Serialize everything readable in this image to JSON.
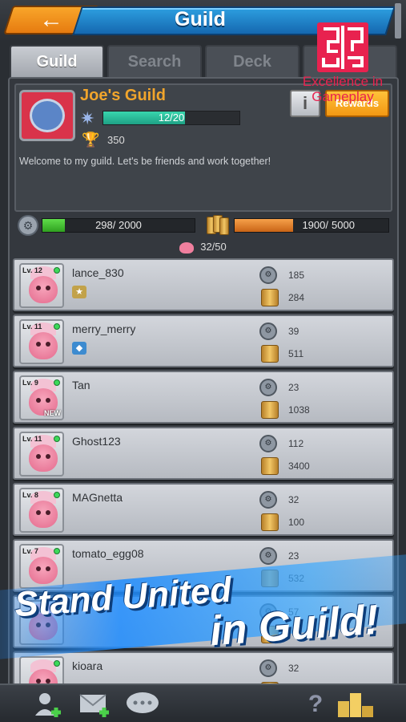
{
  "header": {
    "title": "Guild",
    "back_icon": "←"
  },
  "tabs": [
    {
      "label": "Guild",
      "active": true
    },
    {
      "label": "Search",
      "active": false
    },
    {
      "label": "Deck",
      "active": false
    },
    {
      "label": "",
      "active": false
    }
  ],
  "overlay_logo": {
    "caption": "Excellence in Gameplay"
  },
  "guild": {
    "name": "Joe's Guild",
    "level_text": "12/20",
    "level_progress": 0.6,
    "trophies": "350",
    "info_label": "i",
    "action_label": "Rewards",
    "welcome": "Welcome to my guild. Let's be friends and work together!"
  },
  "resources": {
    "left": {
      "text": "298/ 2000",
      "progress": 0.149
    },
    "right": {
      "text_a": "1900/",
      "text_b": "5000",
      "progress": 0.38
    }
  },
  "member_count": "32/50",
  "members": [
    {
      "level": "Lv. 12",
      "name": "lance_830",
      "stat1": "185",
      "stat2": "284",
      "rank": "★",
      "new": ""
    },
    {
      "level": "Lv. 11",
      "name": "merry_merry",
      "stat1": "39",
      "stat2": "511",
      "rank": "◆",
      "new": ""
    },
    {
      "level": "Lv. 9",
      "name": "Tan",
      "stat1": "23",
      "stat2": "1038",
      "rank": "",
      "new": "NEW"
    },
    {
      "level": "Lv. 11",
      "name": "Ghost123",
      "stat1": "112",
      "stat2": "3400",
      "rank": "",
      "new": ""
    },
    {
      "level": "Lv. 8",
      "name": "MAGnetta",
      "stat1": "32",
      "stat2": "100",
      "rank": "",
      "new": ""
    },
    {
      "level": "Lv. 7",
      "name": "tomato_egg08",
      "stat1": "23",
      "stat2": "532",
      "rank": "",
      "new": ""
    },
    {
      "level": "",
      "name": "",
      "stat1": "57",
      "stat2": "",
      "rank": "",
      "new": ""
    },
    {
      "level": "",
      "name": "kioara",
      "stat1": "32",
      "stat2": "",
      "rank": "",
      "new": ""
    }
  ],
  "banner": {
    "line1": "Stand United",
    "line2": "in Guild!"
  },
  "bottom": {
    "add_friend_icon": "add-user-icon",
    "mail_icon": "mail-icon",
    "chat_icon": "chat-icon",
    "help_label": "?",
    "ranking_icon": "podium-icon"
  },
  "colors": {
    "accent_orange": "#f29813",
    "title_blue": "#1568b0",
    "online_green": "#3cd95a",
    "logo_red": "#e8224f"
  }
}
